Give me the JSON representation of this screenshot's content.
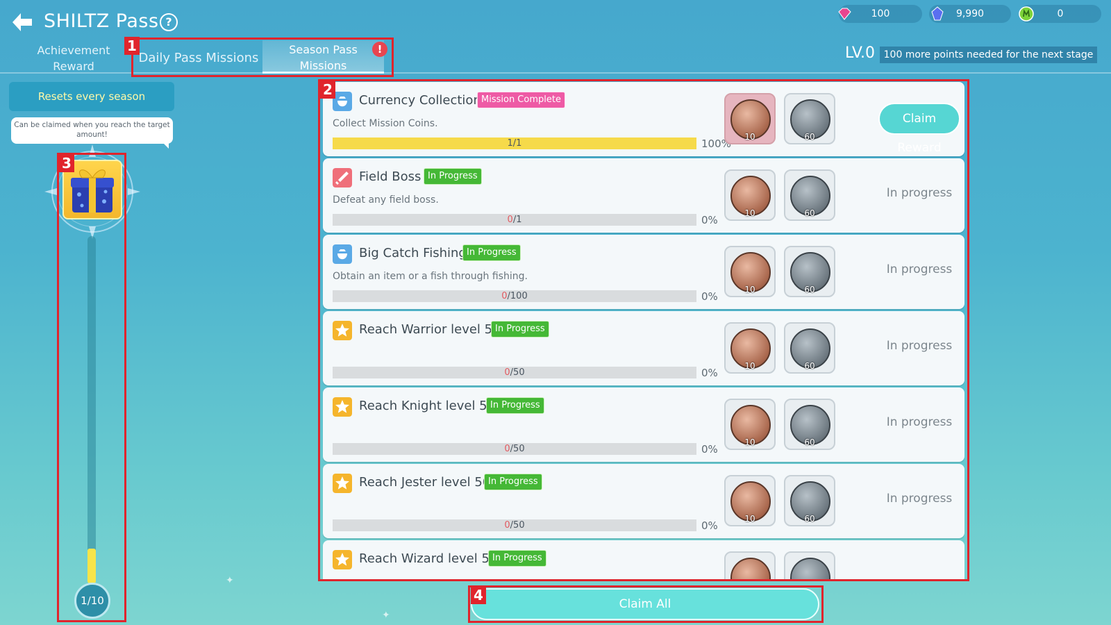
{
  "header": {
    "title": "SHILTZ Pass",
    "help_symbol": "?",
    "tabs": [
      {
        "label_line1": "Achievement",
        "label_line2": "Reward",
        "active": false
      },
      {
        "label": "Daily Pass Missions",
        "active": false
      },
      {
        "label_line1": "Season Pass",
        "label_line2": "Missions",
        "active": true
      }
    ],
    "alert_symbol": "!"
  },
  "currencies": [
    {
      "icon": "pink-gem-icon",
      "value": "100",
      "color": "#e8458f"
    },
    {
      "icon": "blue-crystal-icon",
      "value": "9,990",
      "color": "#5a6ff0"
    },
    {
      "icon": "green-medal-icon",
      "value": "0",
      "color": "#7dd33a"
    }
  ],
  "level": {
    "label": "LV.0",
    "message": "100 more points needed for the next stage"
  },
  "sidebar": {
    "resets_label": "Resets every season",
    "tooltip_line1": "Can be claimed when you reach the target",
    "tooltip_line2": "amount!",
    "progress": "1/10",
    "progress_fraction": 0.1
  },
  "callouts": [
    "1",
    "2",
    "3",
    "4"
  ],
  "missions": [
    {
      "icon": "coin-bag-icon",
      "icon_color": "#5aa9e6",
      "title": "Currency Collection",
      "badge": "Mission Complete",
      "badge_type": "complete",
      "desc": "Collect Mission Coins.",
      "current": "1",
      "target": "1",
      "bar": "1/1",
      "fill": 1.0,
      "pct": "100%",
      "reward1": "10",
      "reward2": "60",
      "action": "Claim Reward",
      "claimable": true
    },
    {
      "icon": "sword-icon",
      "icon_color": "#ef6f7a",
      "title": "Field Boss",
      "badge": "In Progress",
      "badge_type": "progress",
      "desc": "Defeat any field boss.",
      "current": "0",
      "target": "/1",
      "fill": 0,
      "pct": "0%",
      "reward1": "10",
      "reward2": "60",
      "action": "In progress",
      "claimable": false
    },
    {
      "icon": "coin-bag-icon",
      "icon_color": "#5aa9e6",
      "title": "Big Catch Fishing",
      "badge": "In Progress",
      "badge_type": "progress",
      "desc": "Obtain an item or a fish through fishing.",
      "current": "0",
      "target": "/100",
      "fill": 0,
      "pct": "0%",
      "reward1": "10",
      "reward2": "60",
      "action": "In progress",
      "claimable": false
    },
    {
      "icon": "star-icon",
      "icon_color": "#f5b52c",
      "title": "Reach Warrior level 50",
      "badge": "In Progress",
      "badge_type": "progress",
      "desc": "",
      "current": "0",
      "target": "/50",
      "fill": 0,
      "pct": "0%",
      "reward1": "10",
      "reward2": "60",
      "action": "In progress",
      "claimable": false
    },
    {
      "icon": "star-icon",
      "icon_color": "#f5b52c",
      "title": "Reach Knight level 50",
      "badge": "In Progress",
      "badge_type": "progress",
      "desc": "",
      "current": "0",
      "target": "/50",
      "fill": 0,
      "pct": "0%",
      "reward1": "10",
      "reward2": "60",
      "action": "In progress",
      "claimable": false
    },
    {
      "icon": "star-icon",
      "icon_color": "#f5b52c",
      "title": "Reach Jester level 50",
      "badge": "In Progress",
      "badge_type": "progress",
      "desc": "",
      "current": "0",
      "target": "/50",
      "fill": 0,
      "pct": "0%",
      "reward1": "10",
      "reward2": "60",
      "action": "In progress",
      "claimable": false
    },
    {
      "icon": "star-icon",
      "icon_color": "#f5b52c",
      "title": "Reach Wizard level 50",
      "badge": "In Progress",
      "badge_type": "progress",
      "desc": "",
      "current": "",
      "target": "",
      "fill": 0,
      "pct": "",
      "reward1": "",
      "reward2": "",
      "action": "",
      "claimable": false
    }
  ],
  "claim_all_label": "Claim All"
}
